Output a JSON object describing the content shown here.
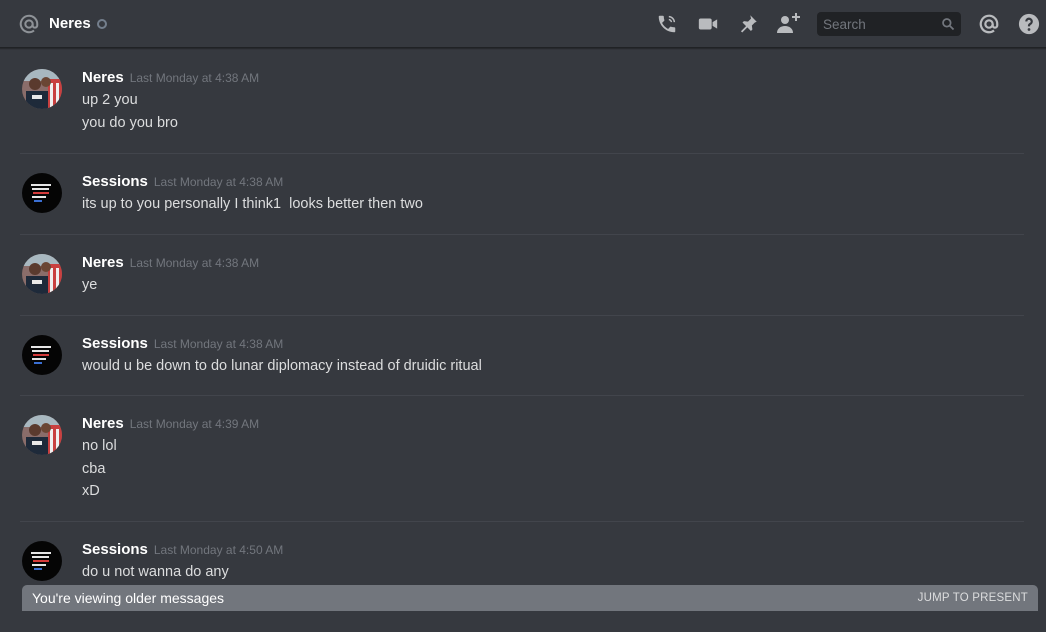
{
  "header": {
    "channel_icon": "at-icon",
    "title": "Neres",
    "status": "offline",
    "toolbar": {
      "call_icon": "phone-call-icon",
      "video_icon": "video-camera-icon",
      "pin_icon": "pin-icon",
      "add_friend_icon": "add-user-icon",
      "search_placeholder": "Search",
      "search_icon": "magnifier-icon",
      "mentions_icon": "at-icon",
      "help_icon": "help-icon"
    }
  },
  "messages": [
    {
      "author": "Neres",
      "timestamp": "Last Monday at 4:38 AM",
      "avatar": "neres-avatar",
      "lines": [
        "up 2 you",
        "you do you bro"
      ]
    },
    {
      "author": "Sessions",
      "timestamp": "Last Monday at 4:38 AM",
      "avatar": "sessions-avatar",
      "lines": [
        "its up to you personally I think1  looks better then two"
      ]
    },
    {
      "author": "Neres",
      "timestamp": "Last Monday at 4:38 AM",
      "avatar": "neres-avatar",
      "lines": [
        "ye"
      ]
    },
    {
      "author": "Sessions",
      "timestamp": "Last Monday at 4:38 AM",
      "avatar": "sessions-avatar",
      "lines": [
        "would u be down to do lunar diplomacy instead of druidic ritual"
      ]
    },
    {
      "author": "Neres",
      "timestamp": "Last Monday at 4:39 AM",
      "avatar": "neres-avatar",
      "lines": [
        "no lol",
        "cba",
        "xD"
      ]
    },
    {
      "author": "Sessions",
      "timestamp": "Last Monday at 4:50 AM",
      "avatar": "sessions-avatar",
      "lines": [
        "do u not wanna do any"
      ]
    }
  ],
  "older_bar": {
    "text": "You're viewing older messages",
    "jump_label": "JUMP TO PRESENT"
  },
  "colors": {
    "background": "#36393f",
    "username": "#ffffff",
    "timestamp": "#72767d",
    "message_text": "#dcddde",
    "older_bar": "#72767d",
    "search_bg": "#202225"
  }
}
